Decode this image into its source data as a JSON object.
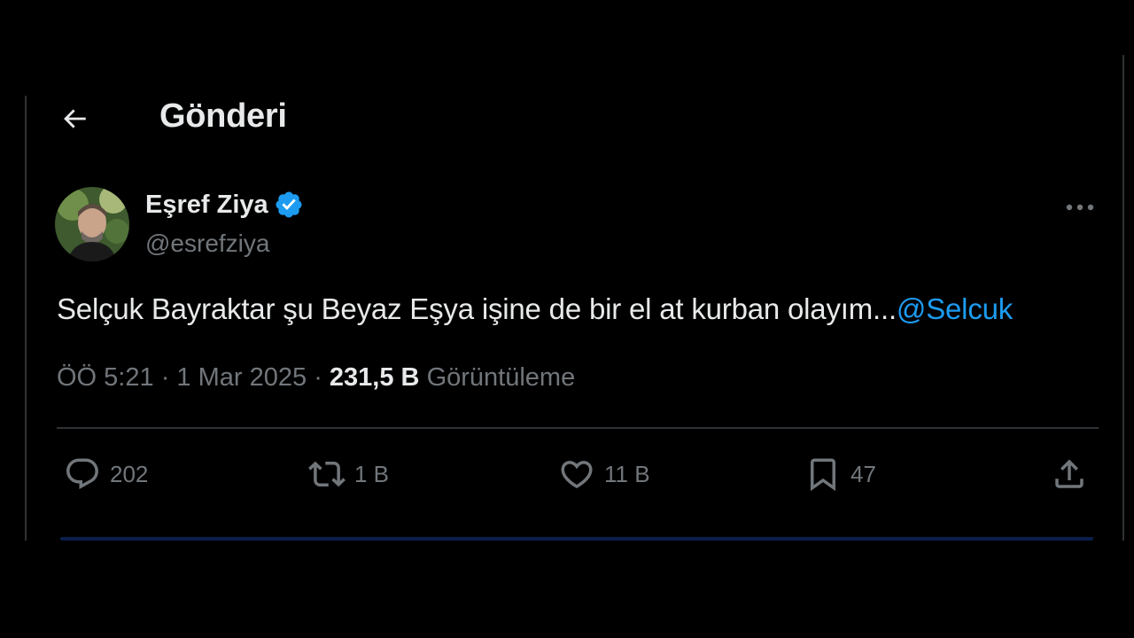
{
  "header": {
    "title": "Gönderi",
    "back_icon": "arrow-left-icon"
  },
  "author": {
    "name": "Eşref Ziya",
    "handle": "@esrefziya",
    "verified": true,
    "verified_color": "#1d9bf0"
  },
  "tweet": {
    "text": "Selçuk Bayraktar şu Beyaz Eşya işine de bir el at kurban olayım...",
    "mention": "@Selcuk"
  },
  "meta": {
    "time": "ÖÖ 5:21",
    "separator": "·",
    "date": "1 Mar 2025",
    "views_count": "231,5 B",
    "views_label": "Görüntüleme"
  },
  "actions": {
    "reply_count": "202",
    "retweet_count": "1 B",
    "like_count": "11 B",
    "bookmark_count": "47"
  },
  "colors": {
    "background": "#000000",
    "text": "#e7e9ea",
    "muted": "#71767b",
    "accent": "#1d9bf0"
  }
}
